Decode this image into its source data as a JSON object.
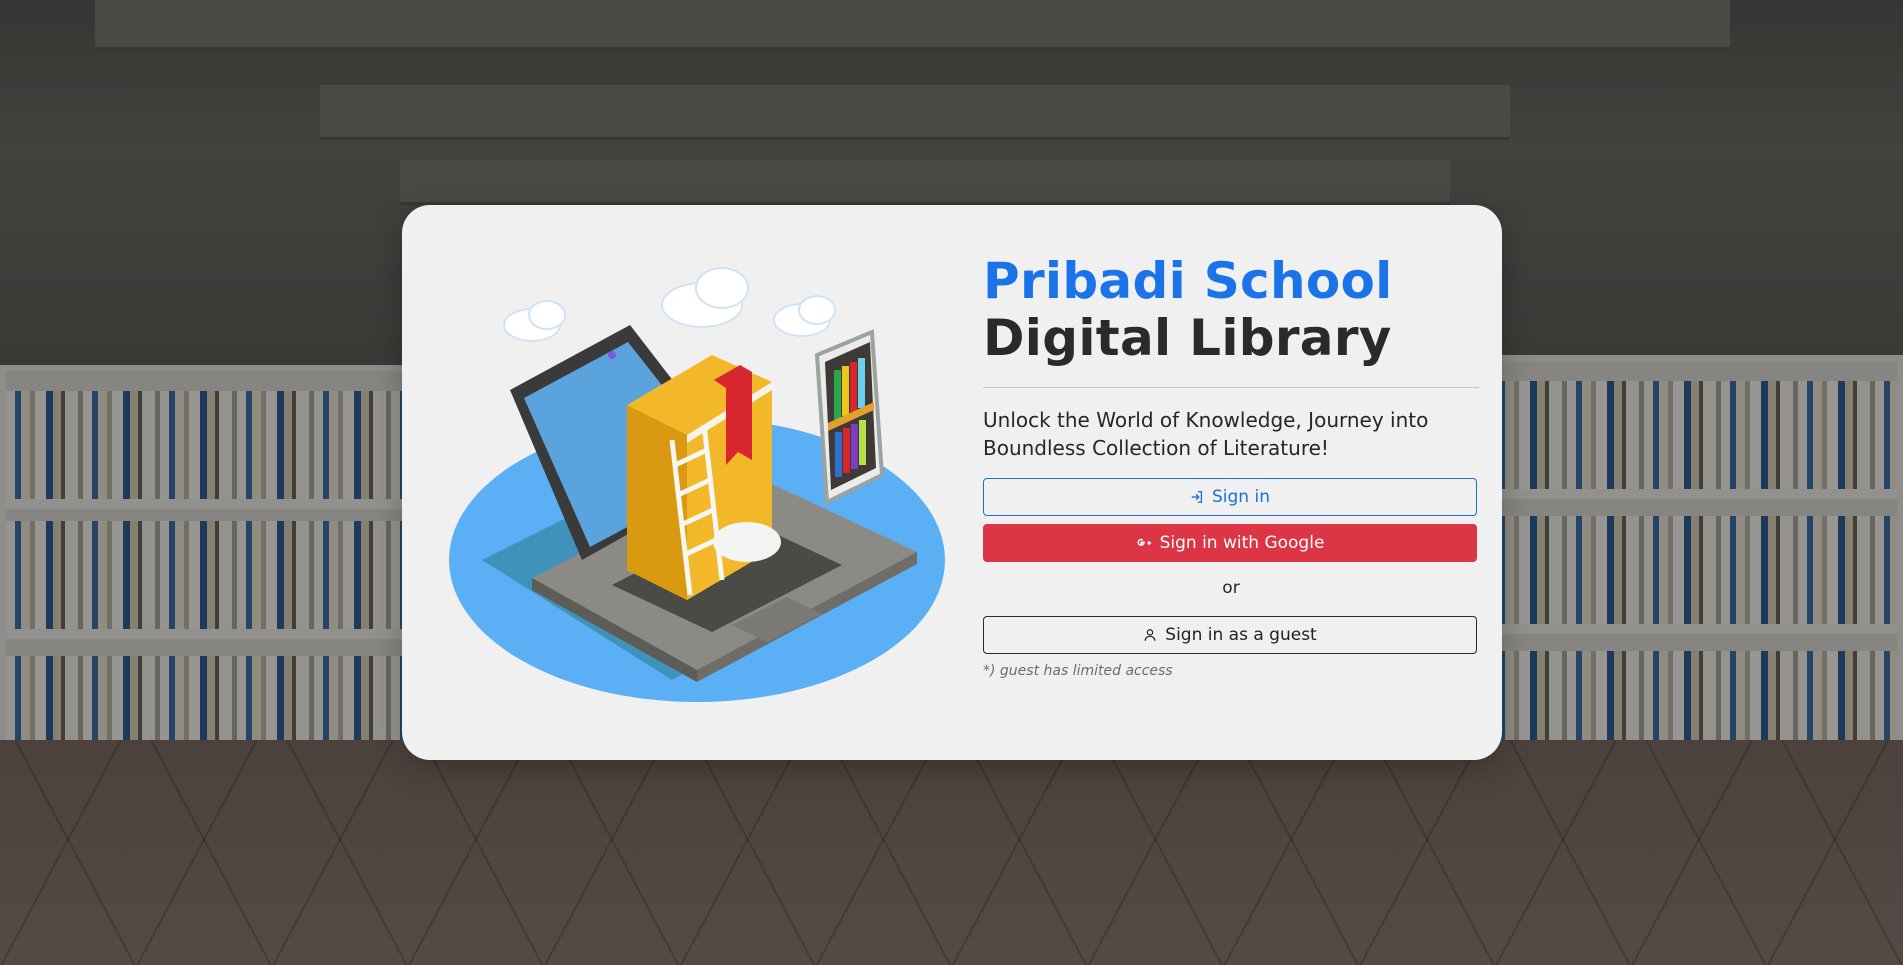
{
  "header": {
    "title_brand": "Pribadi School",
    "title_sub": "Digital Library",
    "tagline": "Unlock the World of Knowledge, Journey into Boundless Collection of Literature!"
  },
  "auth": {
    "signin_label": "Sign in",
    "google_label": "Sign in with Google",
    "or_label": "or",
    "guest_label": "Sign in as a guest",
    "guest_note": "*) guest has limited access"
  },
  "icons": {
    "signin": "login-icon",
    "google": "google-plus-icon",
    "guest": "person-icon"
  },
  "colors": {
    "brand": "#1a73e8",
    "primary_outline": "#1a6fd6",
    "danger": "#dc3545",
    "card_bg": "#f0f0f0"
  }
}
